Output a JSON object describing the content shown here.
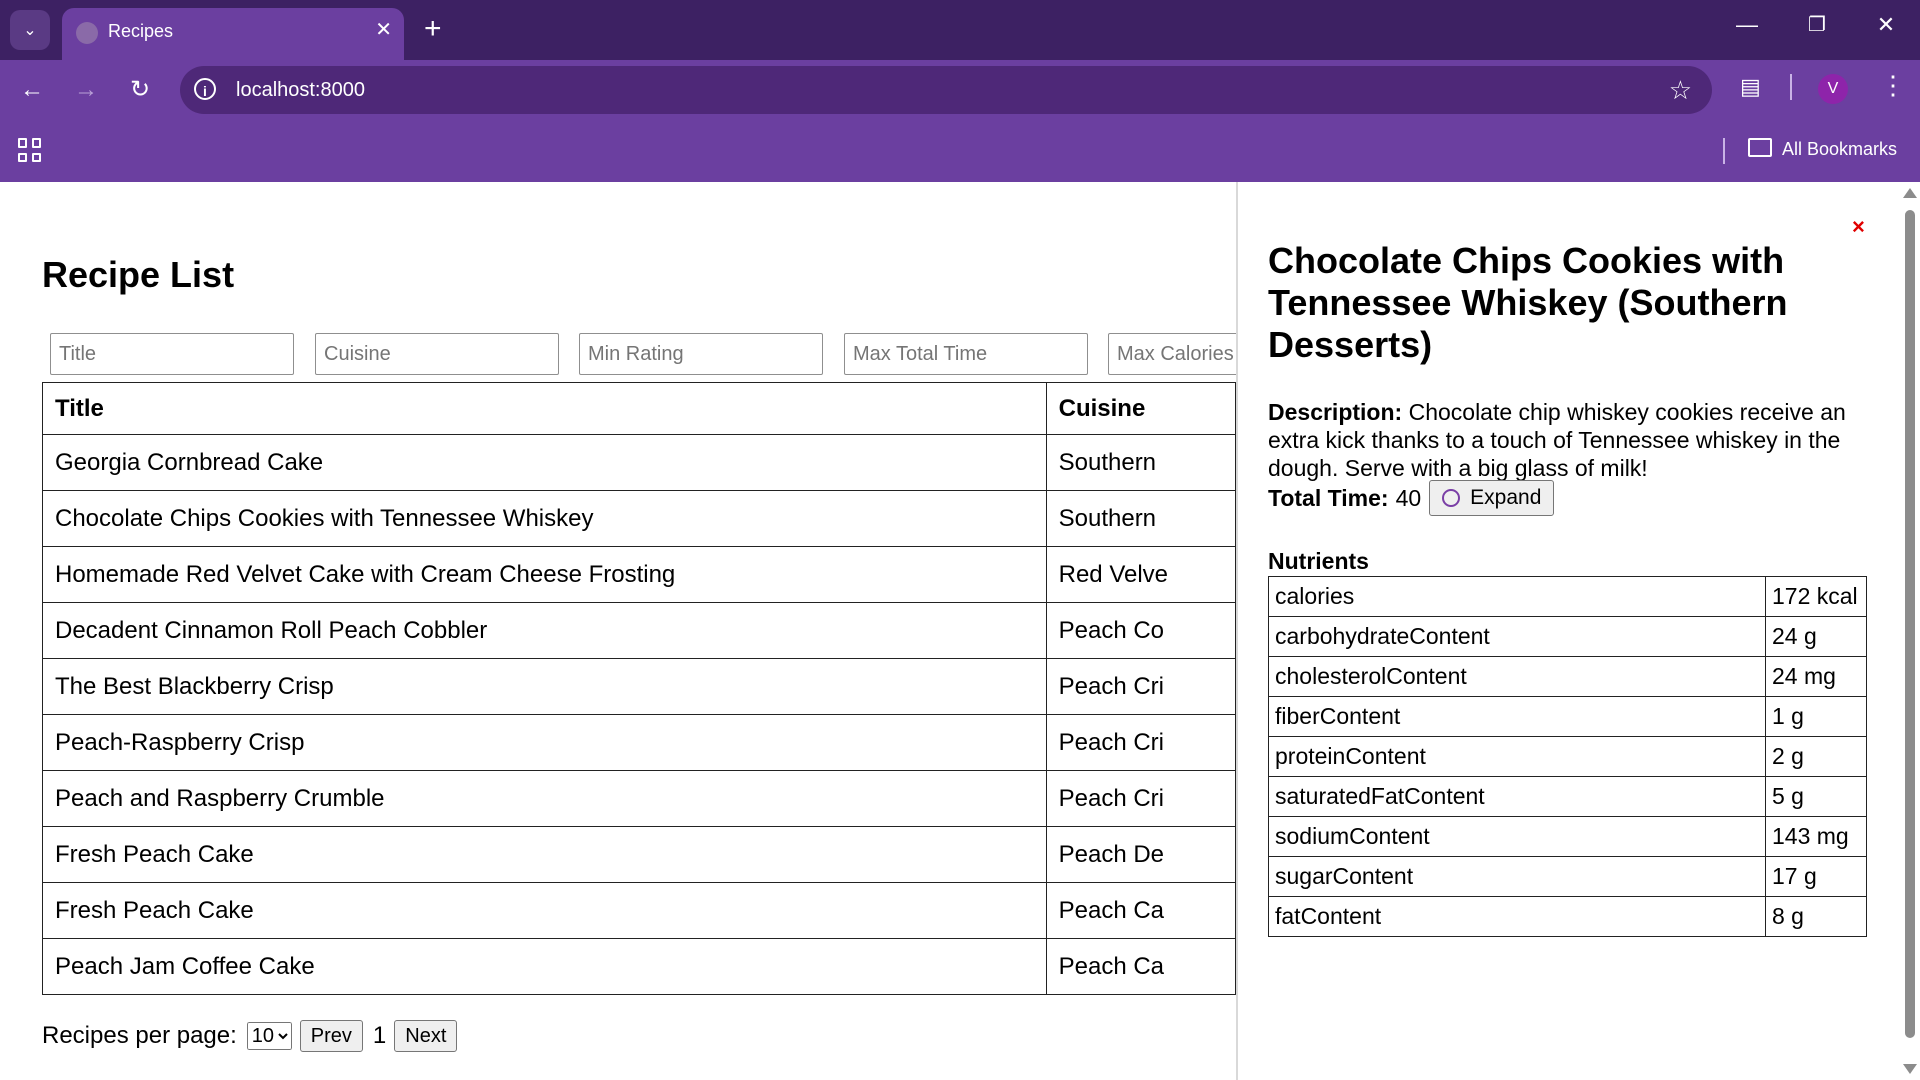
{
  "browser": {
    "tab_title": "Recipes",
    "url": "localhost:8000",
    "avatar_letter": "V",
    "all_bookmarks": "All Bookmarks"
  },
  "page": {
    "title": "Recipe List",
    "filters": {
      "title_placeholder": "Title",
      "cuisine_placeholder": "Cuisine",
      "min_rating_placeholder": "Min Rating",
      "max_total_time_placeholder": "Max Total Time",
      "max_calories_placeholder": "Max Calories"
    },
    "table": {
      "headers": [
        "Title",
        "Cuisine"
      ],
      "rows": [
        {
          "title": "Georgia Cornbread Cake",
          "cuisine": "Southern"
        },
        {
          "title": "Chocolate Chips Cookies with Tennessee Whiskey",
          "cuisine": "Southern"
        },
        {
          "title": "Homemade Red Velvet Cake with Cream Cheese Frosting",
          "cuisine": "Red Velve"
        },
        {
          "title": "Decadent Cinnamon Roll Peach Cobbler",
          "cuisine": "Peach Co"
        },
        {
          "title": "The Best Blackberry Crisp",
          "cuisine": "Peach Cri"
        },
        {
          "title": "Peach-Raspberry Crisp",
          "cuisine": "Peach Cri"
        },
        {
          "title": "Peach and Raspberry Crumble",
          "cuisine": "Peach Cri"
        },
        {
          "title": "Fresh Peach Cake",
          "cuisine": "Peach De"
        },
        {
          "title": "Fresh Peach Cake",
          "cuisine": "Peach Ca"
        },
        {
          "title": "Peach Jam Coffee Cake",
          "cuisine": "Peach Ca"
        }
      ]
    },
    "pager": {
      "label": "Recipes per page:",
      "per_page": "10",
      "prev": "Prev",
      "page": "1",
      "next": "Next"
    }
  },
  "details": {
    "close": "×",
    "title": "Chocolate Chips Cookies with Tennessee Whiskey (Southern Desserts)",
    "description_label": "Description:",
    "description": "Chocolate chip whiskey cookies receive an extra kick thanks to a touch of Tennessee whiskey in the dough. Serve with a big glass of milk!",
    "total_time_label": "Total Time:",
    "total_time": "40",
    "expand": "Expand",
    "nutrients_title": "Nutrients",
    "nutrients": [
      {
        "name": "calories",
        "value": "172 kcal"
      },
      {
        "name": "carbohydrateContent",
        "value": "24 g"
      },
      {
        "name": "cholesterolContent",
        "value": "24 mg"
      },
      {
        "name": "fiberContent",
        "value": "1 g"
      },
      {
        "name": "proteinContent",
        "value": "2 g"
      },
      {
        "name": "saturatedFatContent",
        "value": "5 g"
      },
      {
        "name": "sodiumContent",
        "value": "143 mg"
      },
      {
        "name": "sugarContent",
        "value": "17 g"
      },
      {
        "name": "fatContent",
        "value": "8 g"
      }
    ]
  },
  "colors": {
    "tab_strip": "#3d2163",
    "toolbar": "#6b3fa0",
    "close_red": "#e00000"
  }
}
